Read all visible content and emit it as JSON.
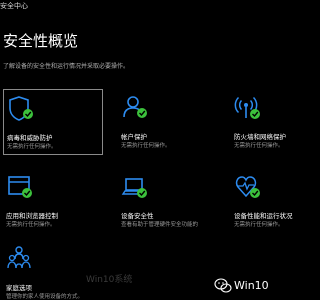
{
  "window": {
    "title": "安全中心"
  },
  "page": {
    "title": "安全性概览",
    "description": "了解设备的安全性和运行情况并采取必要操作。"
  },
  "tiles": [
    {
      "label": "病毒和威胁防护",
      "status": "无需执行任何操作。",
      "icon": "shield-icon"
    },
    {
      "label": "帐户保护",
      "status": "无需执行任何操作。",
      "icon": "account-person-icon"
    },
    {
      "label": "防火墙和网络保护",
      "status": "无需执行任何操作。",
      "icon": "wifi-antenna-icon"
    },
    {
      "label": "应用和浏览器控制",
      "status": "无需执行任何操作。",
      "icon": "browser-window-icon"
    },
    {
      "label": "设备安全性",
      "status": "查看有助于管理硬件安全功能的",
      "icon": "laptop-icon"
    },
    {
      "label": "设备性能和运行状况",
      "status": "无需执行任何操作。",
      "icon": "heart-pulse-icon"
    },
    {
      "label": "家庭选项",
      "status": "管理你的家人使用设备的方式。",
      "icon": "family-icon"
    }
  ],
  "colors": {
    "icon_blue": "#2d8cf0",
    "check_green": "#3cc13c",
    "background": "#000000"
  },
  "watermark": {
    "text": "Win10",
    "faint_text": "Win10系统"
  }
}
